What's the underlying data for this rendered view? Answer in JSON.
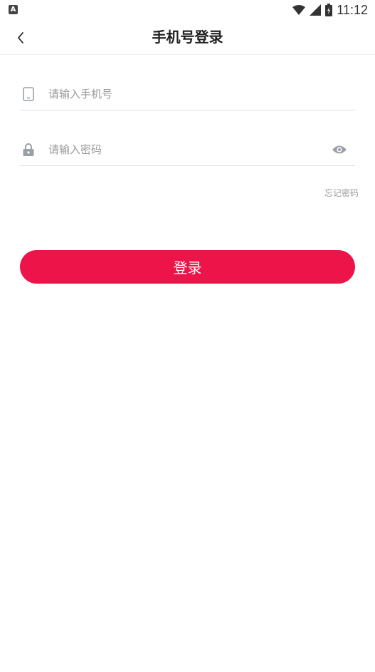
{
  "status_bar": {
    "notification_icon": "a-icon",
    "time": "11:12",
    "wifi_icon": "wifi-icon",
    "signal_icon": "signal-icon",
    "battery_icon": "battery-icon"
  },
  "nav": {
    "back_icon": "chevron-left-icon",
    "title": "手机号登录"
  },
  "form": {
    "phone": {
      "icon": "phone-icon",
      "placeholder": "请输入手机号",
      "value": ""
    },
    "password": {
      "icon": "lock-icon",
      "placeholder": "请输入密码",
      "value": "",
      "toggle_icon": "eye-icon"
    },
    "forgot_label": "忘记密码",
    "login_label": "登录"
  },
  "colors": {
    "accent": "#ec1448",
    "placeholder": "#9a9a9a",
    "divider": "#e2e2e2",
    "icon": "#9aa0a8"
  }
}
